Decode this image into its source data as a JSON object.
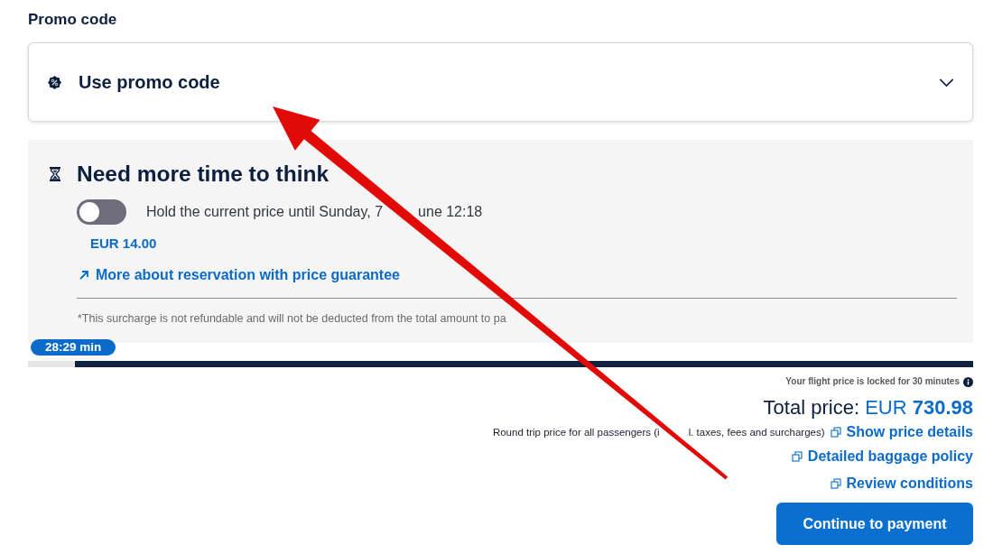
{
  "promo": {
    "heading": "Promo code",
    "toggle_label": "Use promo code",
    "expanded": false
  },
  "hold_price": {
    "title": "Need more time to think",
    "switch": {
      "on": false,
      "label_parts": [
        "Hold the current price until Sunday, 7",
        "une 12:18"
      ]
    },
    "fee": "EUR 14.00",
    "link": "More about reservation with price guarantee",
    "footnote": "*This surcharge is not refundable and will not be deducted from the total amount to pa"
  },
  "timer": {
    "remaining": "28:29 min",
    "level": 0.95
  },
  "summary": {
    "lock_note": "Your flight price is locked for 30 minutes",
    "total_label": "Total price:",
    "currency": "EUR",
    "amount": "730.98",
    "price_note_parts": [
      "Round trip price for all passengers (i",
      "l. taxes, fees and surcharges)"
    ],
    "links": [
      "Show price details",
      "Detailed baggage policy",
      "Review conditions"
    ]
  },
  "buttons": [
    "Continue to payment"
  ]
}
